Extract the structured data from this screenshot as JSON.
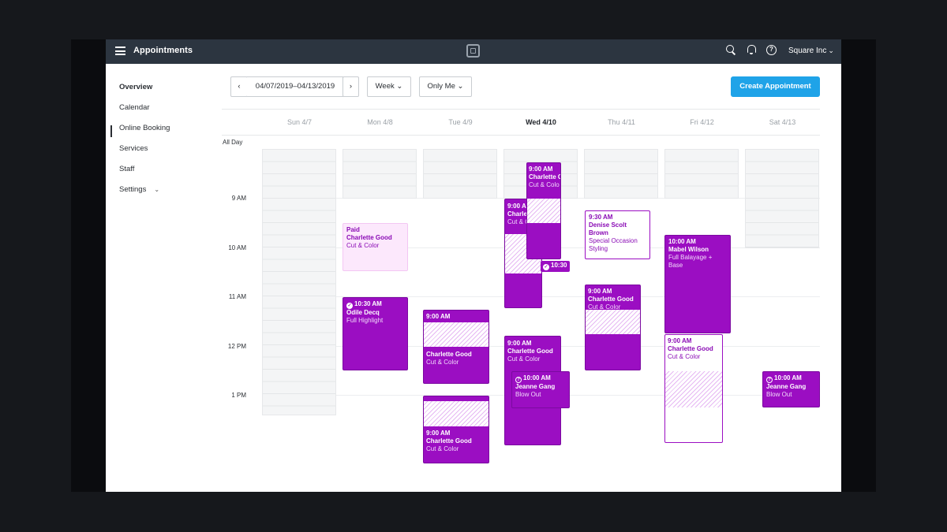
{
  "header": {
    "title": "Appointments",
    "account": "Square Inc",
    "icons": [
      "menu-icon",
      "square-logo",
      "search-icon",
      "bell-icon",
      "help-icon",
      "chevron-down-icon"
    ]
  },
  "sidebar": {
    "items": [
      {
        "label": "Overview"
      },
      {
        "label": "Calendar"
      },
      {
        "label": "Online Booking"
      },
      {
        "label": "Services"
      },
      {
        "label": "Staff"
      },
      {
        "label": "Settings"
      }
    ]
  },
  "toolbar": {
    "prev": "‹",
    "next": "›",
    "date_range": "04/07/2019–04/13/2019",
    "view": "Week",
    "filter": "Only Me",
    "create": "Create Appointment"
  },
  "calendar": {
    "days": [
      "Sun 4/7",
      "Mon 4/8",
      "Tue 4/9",
      "Wed 4/10",
      "Thu 4/11",
      "Fri 4/12",
      "Sat 4/13"
    ],
    "today": "Wed 4/10",
    "all_day": "All Day",
    "hours": [
      "9 AM",
      "10 AM",
      "11 AM",
      "12 PM",
      "1 PM"
    ],
    "appointments": {
      "mon_paid": {
        "status": "Paid",
        "name": "Charlette Good",
        "service": "Cut & Color"
      },
      "mon_odile": {
        "time": "10:30 AM",
        "name": "Odile Decq",
        "service": "Full Highlight"
      },
      "tue_1": {
        "time": "9:00 AM",
        "name": "Charlette Good",
        "service": "Cut & Color"
      },
      "tue_2": {
        "time": "9:00 AM",
        "name": "Charlette Good",
        "service": "Cut & Color"
      },
      "wed_1": {
        "time": "9:00 AM",
        "name": "Charlette G",
        "service": "Cut & Colo"
      },
      "wed_2": {
        "time": "9:00 AM",
        "name": "Charlette G",
        "service": "Cut & Colo"
      },
      "wed_chip": {
        "time": "10:30"
      },
      "wed_3": {
        "time": "9:00 AM",
        "name": "Charlette Good",
        "service": "Cut & Color"
      },
      "wed_4": {
        "time": "10:00 AM",
        "name": "Jeanne Gang",
        "service": "Blow Out"
      },
      "thu_1": {
        "time": "9:30 AM",
        "name": "Denise Scolt Brown",
        "service": "Special Occasion Styling"
      },
      "thu_2": {
        "time": "9:00 AM",
        "name": "Charlette Good",
        "service": "Cut & Color"
      },
      "fri_1": {
        "time": "10:00 AM",
        "name": "Mabel Wilson",
        "service": "Full Balayage + Base"
      },
      "fri_2": {
        "time": "9:00 AM",
        "name": "Charlette Good",
        "service": "Cut & Color"
      },
      "sat_1": {
        "time": "10:00 AM",
        "name": "Jeanne Gang",
        "service": "Blow Out"
      }
    }
  },
  "colors": {
    "topbar": "#2c3540",
    "accent": "#1fa3e8",
    "appointment": "#9b0ec2",
    "paid": "#fce8fc"
  }
}
